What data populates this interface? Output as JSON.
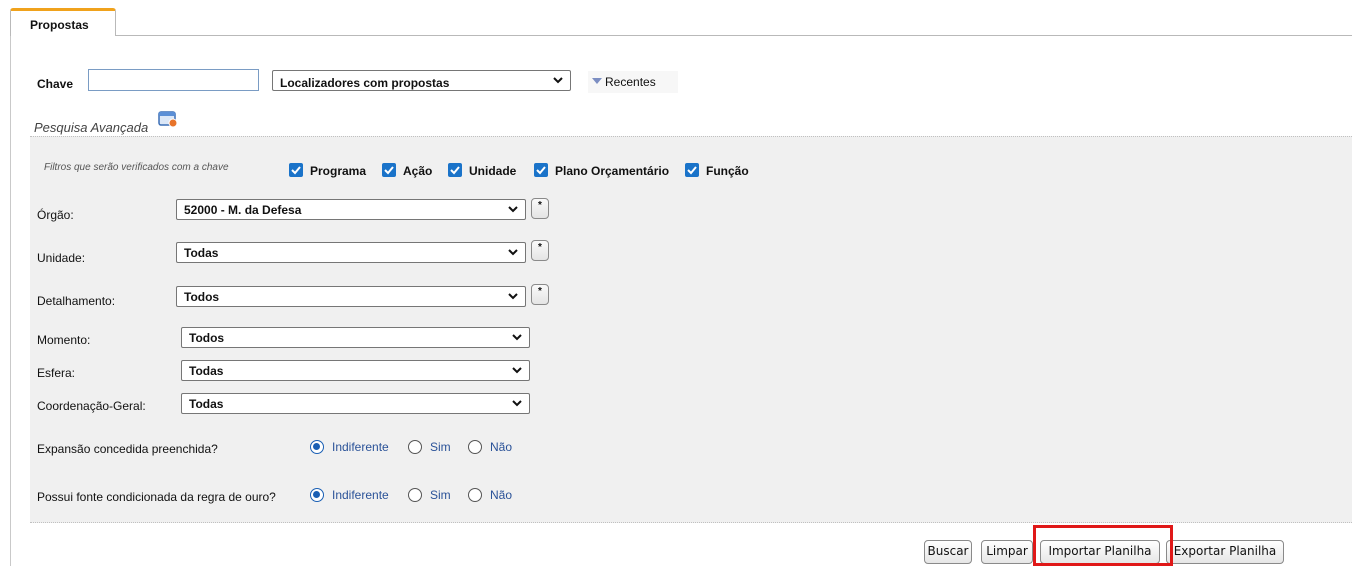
{
  "tab": {
    "label": "Propostas"
  },
  "search": {
    "chave_label": "Chave",
    "chave_value": "",
    "localizadores_selected": "Localizadores com propostas",
    "recentes_label": "Recentes"
  },
  "advanced": {
    "label": "Pesquisa Avançada",
    "filters_note": "Filtros que serão verificados com a chave",
    "checkboxes": [
      {
        "label": "Programa",
        "checked": true
      },
      {
        "label": "Ação",
        "checked": true
      },
      {
        "label": "Unidade",
        "checked": true
      },
      {
        "label": "Plano Orçamentário",
        "checked": true
      },
      {
        "label": "Função",
        "checked": true
      }
    ],
    "fields": {
      "orgao": {
        "label": "Órgão:",
        "value": "52000 - M. da Defesa",
        "star": "*"
      },
      "unidade": {
        "label": "Unidade:",
        "value": "Todas",
        "star": "*"
      },
      "detalhamento": {
        "label": "Detalhamento:",
        "value": "Todos",
        "star": "*"
      },
      "momento": {
        "label": "Momento:",
        "value": "Todos"
      },
      "esfera": {
        "label": "Esfera:",
        "value": "Todas"
      },
      "coordenacao": {
        "label": "Coordenação-Geral:",
        "value": "Todas"
      }
    },
    "expansao": {
      "question": "Expansão concedida preenchida?",
      "options": [
        "Indiferente",
        "Sim",
        "Não"
      ],
      "selected": "Indiferente"
    },
    "regra_ouro": {
      "question": "Possui fonte condicionada da regra de ouro?",
      "options": [
        "Indiferente",
        "Sim",
        "Não"
      ],
      "selected": "Indiferente"
    }
  },
  "buttons": {
    "buscar": "Buscar",
    "limpar": "Limpar",
    "importar": "Importar Planilha",
    "exportar": "Exportar Planilha"
  },
  "colors": {
    "tab_accent": "#f0a21c",
    "checkbox": "#1a73c9",
    "highlight": "#e01818",
    "radio": "#1a5fb4"
  }
}
